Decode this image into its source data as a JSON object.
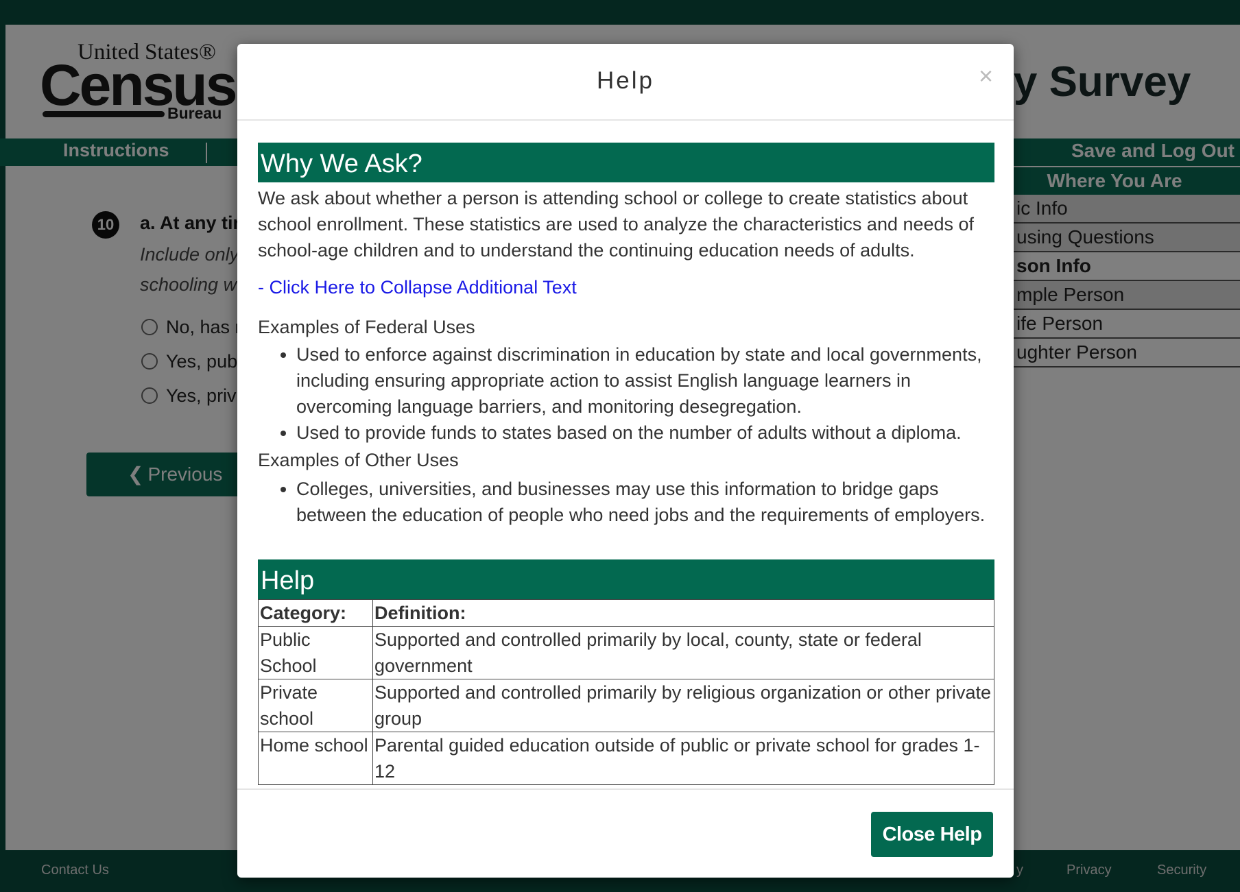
{
  "background": {
    "logo": {
      "line1": "United States®",
      "line2": "Census",
      "line3": "Bureau"
    },
    "page_title": "ity Survey",
    "nav": {
      "instructions": "Instructions",
      "save_logout": "Save and Log Out"
    },
    "sidebar": {
      "header": "Where You Are",
      "items": [
        "ic Info",
        "using Questions",
        "son Info",
        "mple Person",
        "ife Person",
        "ughter Person"
      ]
    },
    "question": {
      "number": "10",
      "text": "a. At any tir",
      "help_line1": "Include only",
      "help_line2": "schooling w",
      "options": [
        "No, has r",
        "Yes, pub",
        "Yes, priv"
      ]
    },
    "previous_button": "Previous",
    "footer": {
      "contact": "Contact Us",
      "partial": "y",
      "privacy": "Privacy",
      "security": "Security"
    }
  },
  "modal": {
    "title": "Help",
    "close_symbol": "×",
    "why_header": "Why We Ask?",
    "why_text": "We ask about whether a person is attending school or college to create statistics about school enrollment. These statistics are used to analyze the characteristics and needs of school-age children and to understand the continuing education needs of adults.",
    "collapse_link": "- Click Here to Collapse Additional Text",
    "federal_heading": "Examples of Federal Uses",
    "federal_uses": [
      "Used to enforce against discrimination in education by state and local governments, including ensuring appropriate action to assist English language learners in overcoming language barriers, and monitoring desegregation.",
      "Used to provide funds to states based on the number of adults without a diploma."
    ],
    "other_heading": "Examples of Other Uses",
    "other_uses": [
      "Colleges, universities, and businesses may use this information to bridge gaps between the education of people who need jobs and the requirements of employers."
    ],
    "help_header": "Help",
    "table": {
      "headers": [
        "Category:",
        "Definition:"
      ],
      "rows": [
        [
          "Public School",
          "Supported and controlled primarily by local, county, state or federal government"
        ],
        [
          "Private school",
          "Supported and controlled primarily by religious organization or other private group"
        ],
        [
          "Home school",
          "Parental guided education outside of public or private school for grades 1-12"
        ]
      ]
    },
    "close_button": "Close Help"
  },
  "colors": {
    "brand_green": "#036950",
    "dark_green": "#0b4d3f",
    "link_blue": "#1a1ae6"
  }
}
